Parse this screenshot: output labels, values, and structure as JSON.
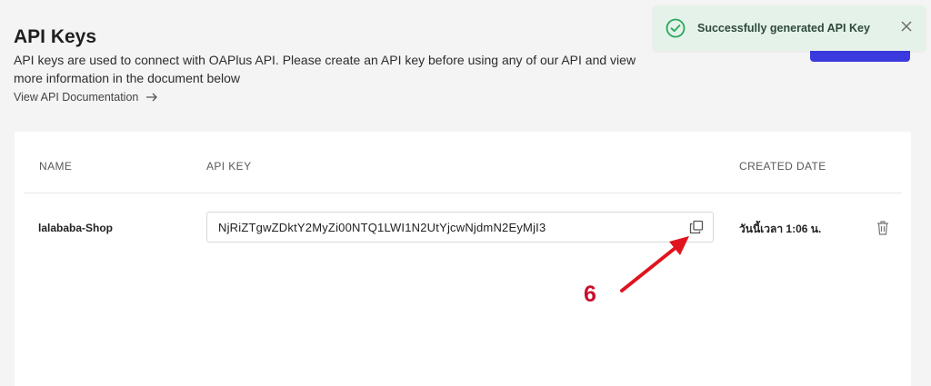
{
  "header": {
    "title": "API Keys",
    "description": "API keys are used to connect with OAPlus API. Please create an API key before using any of our API and view more information in the document below",
    "doc_link": "View API Documentation"
  },
  "toast": {
    "message": "Successfully generated API Key"
  },
  "table": {
    "columns": {
      "name": "NAME",
      "api_key": "API KEY",
      "created_date": "CREATED DATE"
    },
    "rows": [
      {
        "name": "lalababa-Shop",
        "api_key": "NjRiZTgwZDktY2MyZi00NTQ1LWI1N2UtYjcwNjdmN2EyMjI3",
        "created_date": "วันนี้เวลา 1:06 น."
      }
    ]
  },
  "annotation": {
    "number": "6",
    "color": "#c8102e"
  },
  "colors": {
    "primary_button": "#3a3adf",
    "toast_background": "#e5f2ea",
    "success": "#27a85a"
  }
}
